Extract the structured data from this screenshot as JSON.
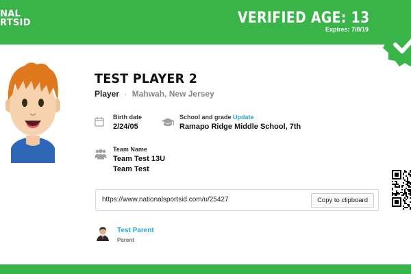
{
  "brand": {
    "logo_line1": "NAL",
    "logo_line2": "RTSID"
  },
  "header": {
    "verified_age": "VERIFIED AGE: 13",
    "expires": "Expires: 7/8/19"
  },
  "profile": {
    "name": "TEST PLAYER 2",
    "role": "Player",
    "separator": "·",
    "location": "Mahwah, New Jersey"
  },
  "fields": {
    "birth_date_label": "Birth date",
    "birth_date": "2/24/05",
    "school_label": "School and grade",
    "school_update": "Update",
    "school": "Ramapo Ridge Middle School, 7th",
    "team_label": "Team Name",
    "teams": [
      "Team Test 13U",
      "Team Test"
    ]
  },
  "share": {
    "url": "https://www.nationalsportsid.com/u/25427",
    "copy_label": "Copy to clipboard"
  },
  "parent": {
    "name": "Test Parent",
    "role": "Parent"
  },
  "colors": {
    "brand_green": "#38b449",
    "link_blue": "#2aa5d8"
  },
  "icons": [
    "calendar-icon",
    "graduation-cap-icon",
    "team-icon",
    "checkmark-seal-icon",
    "qr-code"
  ]
}
